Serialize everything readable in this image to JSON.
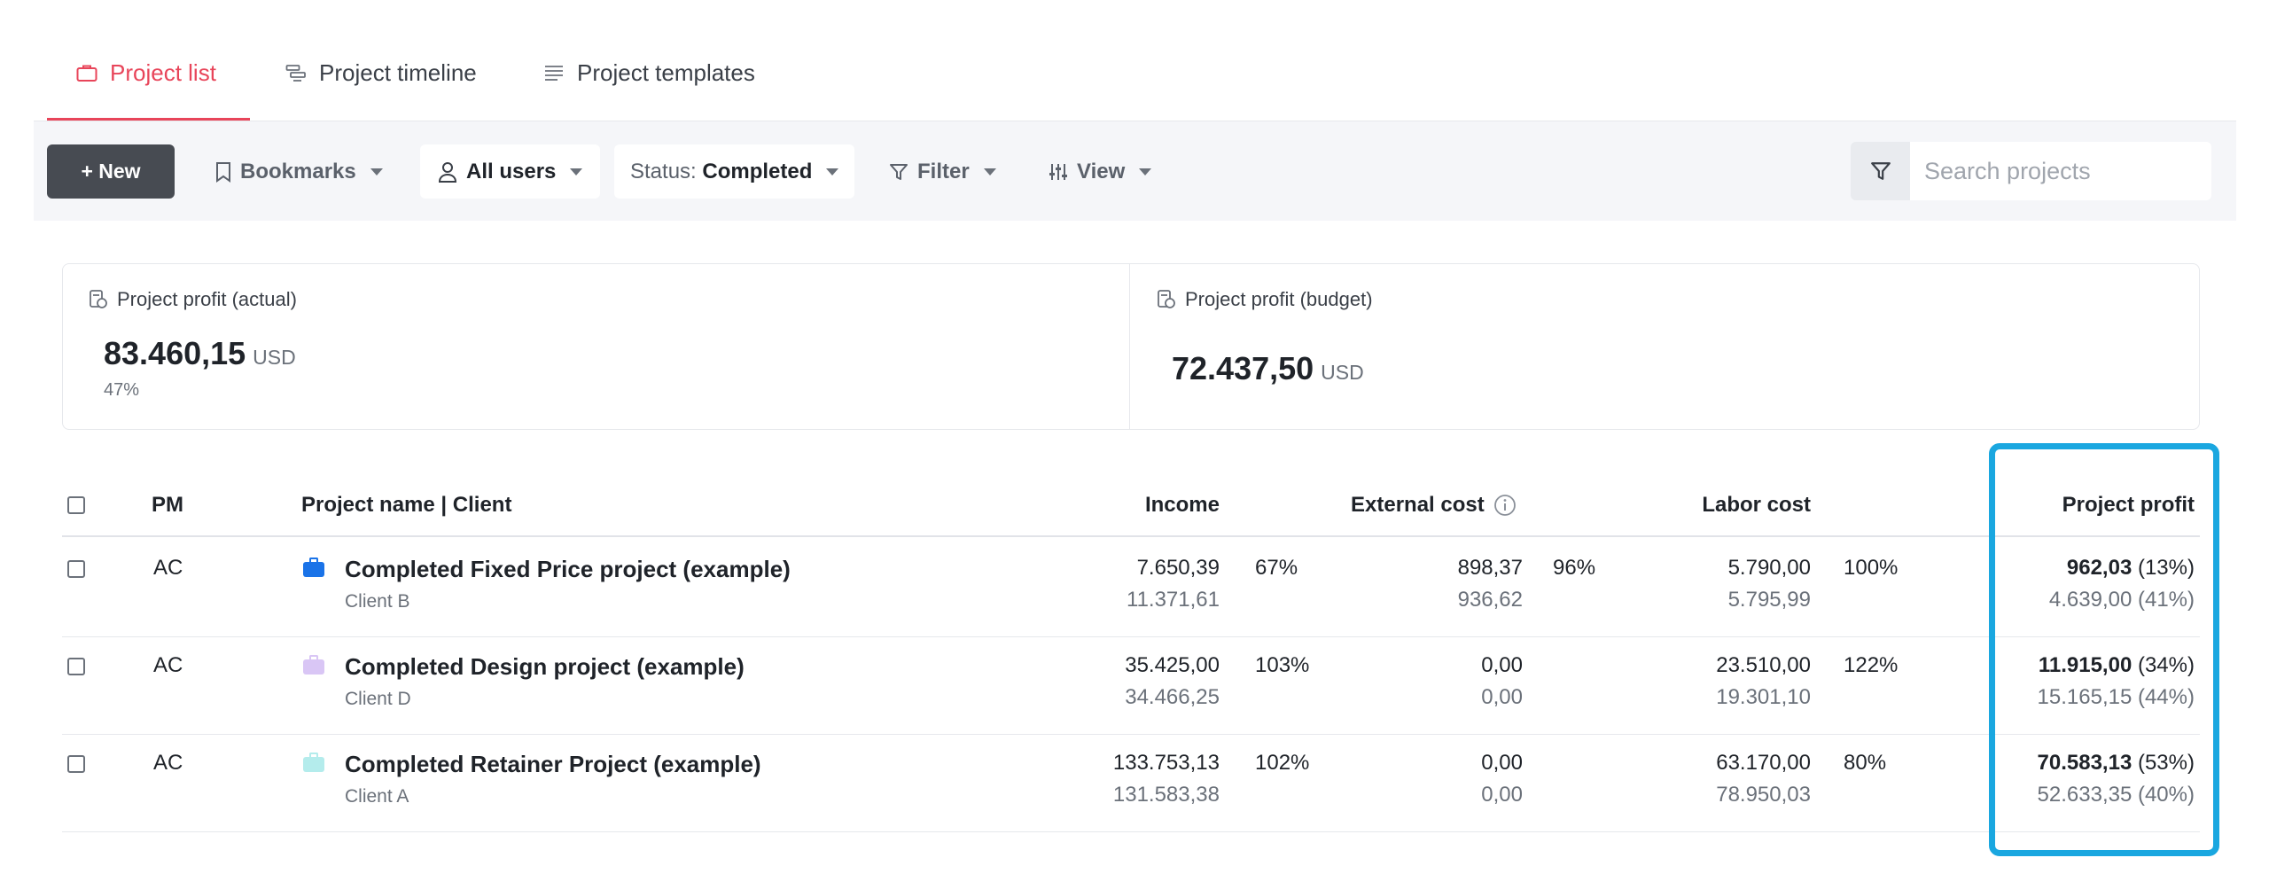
{
  "tabs": [
    {
      "label": "Project list",
      "active": true
    },
    {
      "label": "Project timeline",
      "active": false
    },
    {
      "label": "Project templates",
      "active": false
    }
  ],
  "toolbar": {
    "new_label": "+ New",
    "bookmarks_label": "Bookmarks",
    "users_label": "All users",
    "status_prefix": "Status: ",
    "status_value": "Completed",
    "filter_label": "Filter",
    "view_label": "View",
    "search_placeholder": "Search projects"
  },
  "stats": {
    "actual": {
      "label": "Project profit (actual)",
      "value": "83.460,15",
      "unit": "USD",
      "pct": "47%"
    },
    "budget": {
      "label": "Project profit (budget)",
      "value": "72.437,50",
      "unit": "USD"
    }
  },
  "table": {
    "headers": {
      "pm": "PM",
      "name": "Project name | Client",
      "income": "Income",
      "external": "External cost",
      "labor": "Labor cost",
      "profit": "Project profit"
    },
    "rows": [
      {
        "pm": "AC",
        "name": "Completed Fixed Price project (example)",
        "client": "Client B",
        "icon_color": "#1a73e8",
        "income_actual": "7.650,39",
        "income_budget": "11.371,61",
        "income_pct": "67%",
        "ext_actual": "898,37",
        "ext_budget": "936,62",
        "ext_pct": "96%",
        "labor_actual": "5.790,00",
        "labor_budget": "5.795,99",
        "labor_pct": "100%",
        "profit_actual": "962,03",
        "profit_actual_pct": "(13%)",
        "profit_budget": "4.639,00 (41%)"
      },
      {
        "pm": "AC",
        "name": "Completed Design project (example)",
        "client": "Client D",
        "icon_color": "#d9c6f5",
        "income_actual": "35.425,00",
        "income_budget": "34.466,25",
        "income_pct": "103%",
        "ext_actual": "0,00",
        "ext_budget": "0,00",
        "ext_pct": "",
        "labor_actual": "23.510,00",
        "labor_budget": "19.301,10",
        "labor_pct": "122%",
        "profit_actual": "11.915,00",
        "profit_actual_pct": "(34%)",
        "profit_budget": "15.165,15 (44%)"
      },
      {
        "pm": "AC",
        "name": "Completed Retainer Project (example)",
        "client": "Client A",
        "icon_color": "#b4ecec",
        "income_actual": "133.753,13",
        "income_budget": "131.583,38",
        "income_pct": "102%",
        "ext_actual": "0,00",
        "ext_budget": "0,00",
        "ext_pct": "",
        "labor_actual": "63.170,00",
        "labor_budget": "78.950,03",
        "labor_pct": "80%",
        "profit_actual": "70.583,13",
        "profit_actual_pct": "(53%)",
        "profit_budget": "52.633,35 (40%)"
      }
    ]
  },
  "colors": {
    "accent": "#e8455a",
    "highlight": "#1aa7e0",
    "new_button": "#474b52"
  }
}
